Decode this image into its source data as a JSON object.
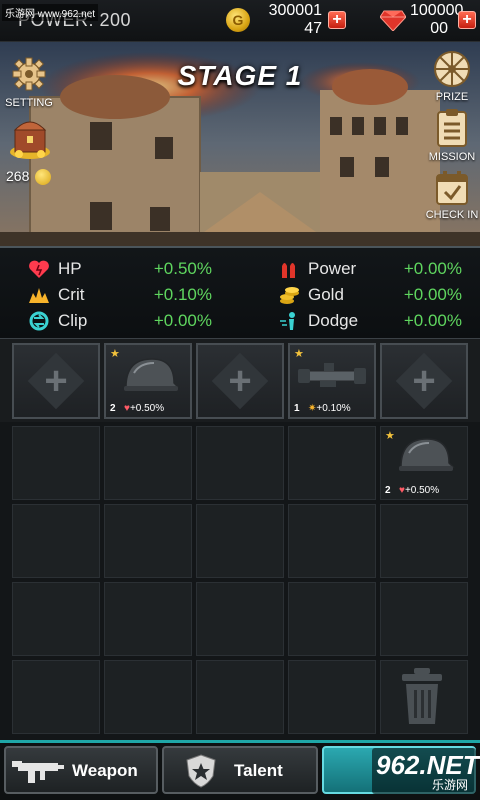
{
  "watermark_top": "乐游网 www.962.net",
  "header": {
    "power_label": "POWER:",
    "power_value": "200",
    "gold_value": "300001",
    "gold_sub": "47",
    "gem_value": "100000",
    "gem_sub": "00",
    "coin_glyph": "G"
  },
  "scene": {
    "stage_title": "STAGE 1",
    "setting_label": "SETTING",
    "chest_amount": "268",
    "prize_label": "PRIZE",
    "mission_label": "MISSION",
    "checkin_label": "CHECK IN"
  },
  "stats": [
    {
      "name": "HP",
      "value": "+0.50%",
      "icon": "heart-icon"
    },
    {
      "name": "Crit",
      "value": "+0.10%",
      "icon": "crit-icon"
    },
    {
      "name": "Clip",
      "value": "+0.00%",
      "icon": "clip-icon"
    },
    {
      "name": "Power",
      "value": "+0.00%",
      "icon": "bullets-icon"
    },
    {
      "name": "Gold",
      "value": "+0.00%",
      "icon": "coins-icon"
    },
    {
      "name": "Dodge",
      "value": "+0.00%",
      "icon": "dodge-icon"
    }
  ],
  "equip": [
    {
      "empty": true
    },
    {
      "empty": false,
      "count": "2",
      "bonus": "+0.50%",
      "item": "helmet-icon"
    },
    {
      "empty": true
    },
    {
      "empty": false,
      "count": "1",
      "bonus": "+0.10%",
      "item": "scope-icon"
    },
    {
      "empty": true
    }
  ],
  "inventory_item": {
    "count": "2",
    "bonus": "+0.50%",
    "item": "helmet-icon"
  },
  "tabs": {
    "weapon": "Weapon",
    "talent": "Talent"
  },
  "watermark_bottom": {
    "big": "962.NET",
    "small": "乐游网"
  },
  "colors": {
    "accent": "#1fa7a7",
    "positive": "#5fd65f",
    "plus": "#c61f10"
  }
}
